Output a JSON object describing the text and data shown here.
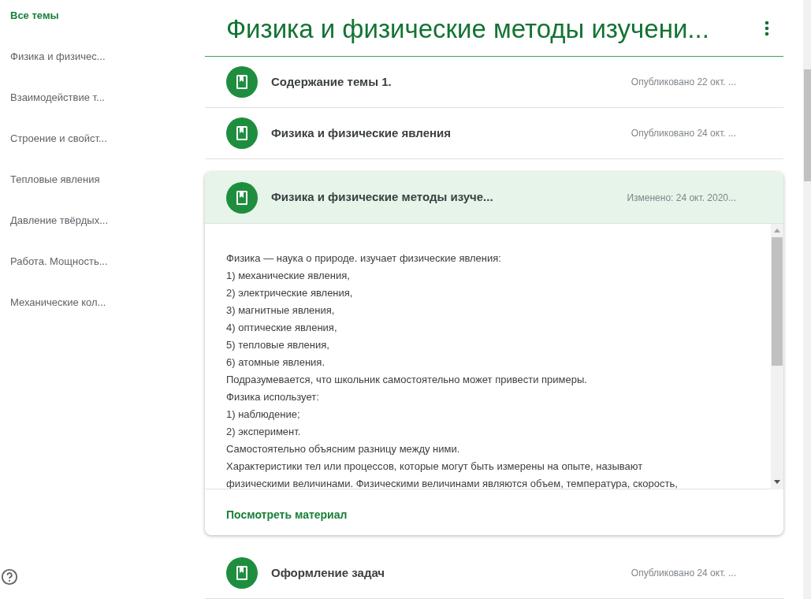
{
  "sidebar": {
    "items": [
      {
        "label": "Все темы",
        "selected": true
      },
      {
        "label": "Физика и физичес...",
        "selected": false
      },
      {
        "label": "Взаимодействие т...",
        "selected": false
      },
      {
        "label": "Строение и свойст...",
        "selected": false
      },
      {
        "label": "Тепловые явления",
        "selected": false
      },
      {
        "label": "Давление твёрдых...",
        "selected": false
      },
      {
        "label": "Работа. Мощность...",
        "selected": false
      },
      {
        "label": "Механические кол...",
        "selected": false
      }
    ]
  },
  "topic": {
    "title": "Физика и физические методы изучени...",
    "materials": [
      {
        "title": "Содержание темы 1.",
        "date": "Опубликовано 22 окт. ...",
        "expanded": false
      },
      {
        "title": "Физика и физические явления",
        "date": "Опубликовано 24 окт. ...",
        "expanded": false
      },
      {
        "title": "Физика и физические методы изуче...",
        "date": "Изменено: 24 окт. 2020...",
        "expanded": true,
        "body": [
          "Физика — наука о природе. изучает физические явления:",
          "1) механические явления,",
          "2) электрические явления,",
          "3) магнитные явления,",
          "4) оптические явления,",
          "5) тепловые явления,",
          "6) атомные явления.",
          "Подразумевается, что школьник самостоятельно может привести примеры.",
          "Физика использует:",
          "1) наблюдение;",
          "2) эксперимент.",
          "Самостоятельно объясним разницу между ними.",
          "Характеристики тел или процессов, которые могут быть измерены на опыте, называют",
          "физическими величинами. Физическими величинами являются объем, температура, скорость,"
        ],
        "link": "Посмотреть материал"
      },
      {
        "title": "Оформление задач",
        "date": "Опубликовано 24 окт. ...",
        "expanded": false
      }
    ]
  }
}
